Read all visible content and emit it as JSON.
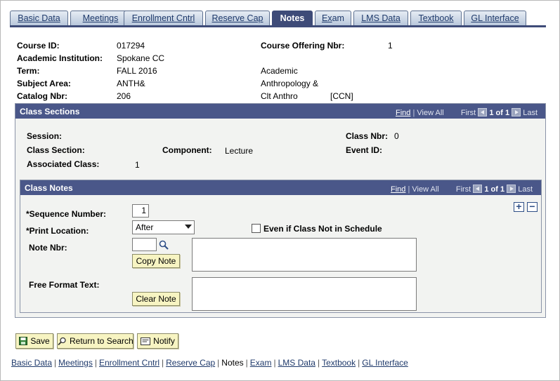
{
  "tabs": [
    {
      "u": "B",
      "rest": "asic Data"
    },
    {
      "u": "M",
      "rest": "eetings"
    },
    {
      "u": "E",
      "rest": "nrollment Cntrl"
    },
    {
      "u": "R",
      "rest": "eserve Cap"
    },
    {
      "u": "",
      "rest": "Notes"
    },
    {
      "u": "Ex",
      "rest": "am"
    },
    {
      "u": "L",
      "rest": "MS Data"
    },
    {
      "u": "T",
      "rest": "extbook"
    },
    {
      "u": "G",
      "rest": "L Interface"
    }
  ],
  "header": {
    "course_id_label": "Course ID:",
    "course_id": "017294",
    "institution_label": "Academic Institution:",
    "institution": "Spokane CC",
    "term_label": "Term:",
    "term": "FALL 2016",
    "term_desc": "Academic",
    "subject_label": "Subject Area:",
    "subject": "ANTH&",
    "subject_desc": "Anthropology &",
    "catalog_label": "Catalog Nbr:",
    "catalog": "206",
    "catalog_desc": "Clt Anthro",
    "catalog_tag": "[CCN]",
    "offering_label": "Course Offering Nbr:",
    "offering": "1"
  },
  "class_sections": {
    "title": "Class Sections",
    "find": "Find",
    "view_all": "View All",
    "first": "First",
    "count": "1 of 1",
    "last": "Last",
    "session_label": "Session:",
    "class_section_label": "Class Section:",
    "component_label": "Component:",
    "component": "Lecture",
    "assoc_label": "Associated Class:",
    "assoc": "1",
    "class_nbr_label": "Class Nbr:",
    "class_nbr": "0",
    "event_id_label": "Event ID:"
  },
  "class_notes": {
    "title": "Class Notes",
    "find": "Find",
    "view_all": "View All",
    "first": "First",
    "count": "1 of 1",
    "last": "Last",
    "seq_label": "*Sequence Number:",
    "seq_value": "1",
    "print_loc_label": "*Print Location:",
    "print_loc_value": "After",
    "even_if_label": "Even if Class Not in Schedule",
    "note_nbr_label": "Note Nbr:",
    "copy_note": "Copy Note",
    "free_text_label": "Free Format Text:",
    "clear_note": "Clear Note",
    "plus": "+",
    "minus": "−"
  },
  "actions": {
    "save": "Save",
    "return": "Return to Search",
    "notify": "Notify"
  },
  "bottom_links": [
    "Basic Data",
    "Meetings",
    "Enrollment Cntrl",
    "Reserve Cap",
    "Notes",
    "Exam",
    "LMS Data",
    "Textbook",
    "GL Interface"
  ]
}
